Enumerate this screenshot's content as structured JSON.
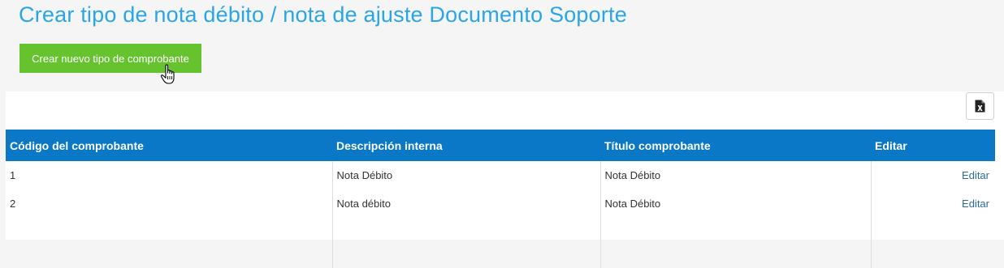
{
  "page": {
    "title": "Crear tipo de nota débito / nota de ajuste Documento Soporte"
  },
  "actions": {
    "create_label": "Crear nuevo tipo de comprobante",
    "export_icon": "excel-export-icon"
  },
  "table": {
    "headers": [
      "Código del comprobante",
      "Descripción interna",
      "Título comprobante",
      "Editar"
    ],
    "rows": [
      {
        "code": "1",
        "description": "Nota Débito",
        "title": "Nota Débito",
        "edit": "Editar"
      },
      {
        "code": "2",
        "description": "Nota débito",
        "title": "Nota Débito",
        "edit": "Editar"
      }
    ]
  },
  "colors": {
    "title": "#2aa6e8",
    "create_button": "#66c22f",
    "table_header": "#0a78c6",
    "link": "#2c6a9c"
  }
}
